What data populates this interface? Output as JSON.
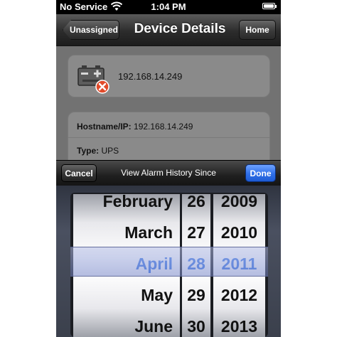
{
  "status_bar": {
    "carrier": "No Service",
    "time": "1:04 PM"
  },
  "nav": {
    "back_label": "Unassigned",
    "title": "Device Details",
    "home_label": "Home"
  },
  "device": {
    "ip": "192.168.14.249"
  },
  "details": {
    "hostname_label": "Hostname/IP:",
    "hostname_value": "192.168.14.249",
    "type_label": "Type:",
    "type_value": "UPS"
  },
  "toolbar": {
    "cancel_label": "Cancel",
    "title": "View Alarm History Since",
    "done_label": "Done"
  },
  "picker": {
    "months": [
      "February",
      "March",
      "April",
      "May",
      "June"
    ],
    "days": [
      "26",
      "27",
      "28",
      "29",
      "30"
    ],
    "years": [
      "2009",
      "2010",
      "2011",
      "2012",
      "2013"
    ],
    "selected": {
      "month": "April",
      "day": "28",
      "year": "2011"
    }
  },
  "colors": {
    "selected_text": "#3a76e6",
    "done_button": "#2f6fe8",
    "error_badge": "#e04a2a"
  }
}
